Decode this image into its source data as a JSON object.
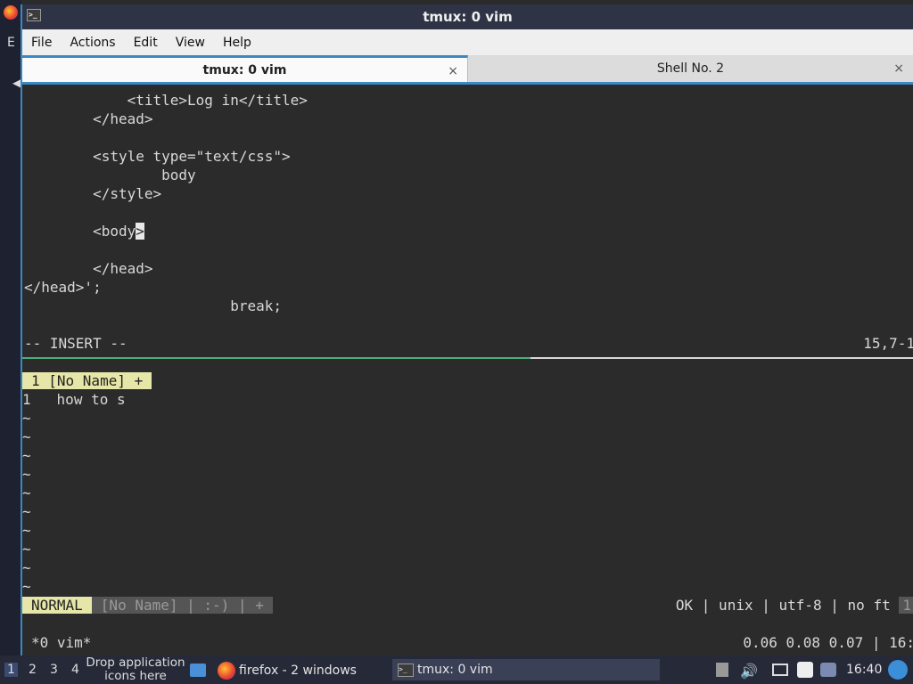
{
  "window": {
    "title": "tmux: 0 vim"
  },
  "menu": [
    "File",
    "Actions",
    "Edit",
    "View",
    "Help"
  ],
  "tabs": [
    {
      "label": "tmux: 0 vim",
      "close": "×"
    },
    {
      "label": "Shell No. 2",
      "close": "×"
    }
  ],
  "vim_top": {
    "lines": [
      "            <title>Log in</title>",
      "        </head>",
      "",
      "        <style type=\"text/css\">",
      "                body",
      "        </style>",
      "",
      "        <body",
      "",
      "        </head>",
      "</head>';",
      "                        break;"
    ],
    "cursor_char": ">",
    "mode": "-- INSERT --",
    "position": "15,7-1"
  },
  "vim_bottom": {
    "buffer_tab": "1 [No Name] +",
    "line_number": "1",
    "line_text": "how to s",
    "tilde": "~",
    "status_mode": "NORMAL",
    "status_name": "[No Name] | :-) | +",
    "status_right": "OK | unix | utf-8 | no ft",
    "status_right_extra": "1"
  },
  "tmux_status": {
    "left": "*0 vim*",
    "right": "0.06 0.08 0.07 | 16:"
  },
  "taskbar": {
    "workspaces": [
      "1",
      "2",
      "3",
      "4"
    ],
    "drop_text": "Drop application icons here",
    "apps": [
      {
        "label": "firefox - 2 windows",
        "icon": "firefox-icon"
      },
      {
        "label": "tmux: 0 vim",
        "icon": "terminal-icon"
      }
    ],
    "clock": "16:40"
  },
  "desktop": {
    "left_letter": "E"
  }
}
